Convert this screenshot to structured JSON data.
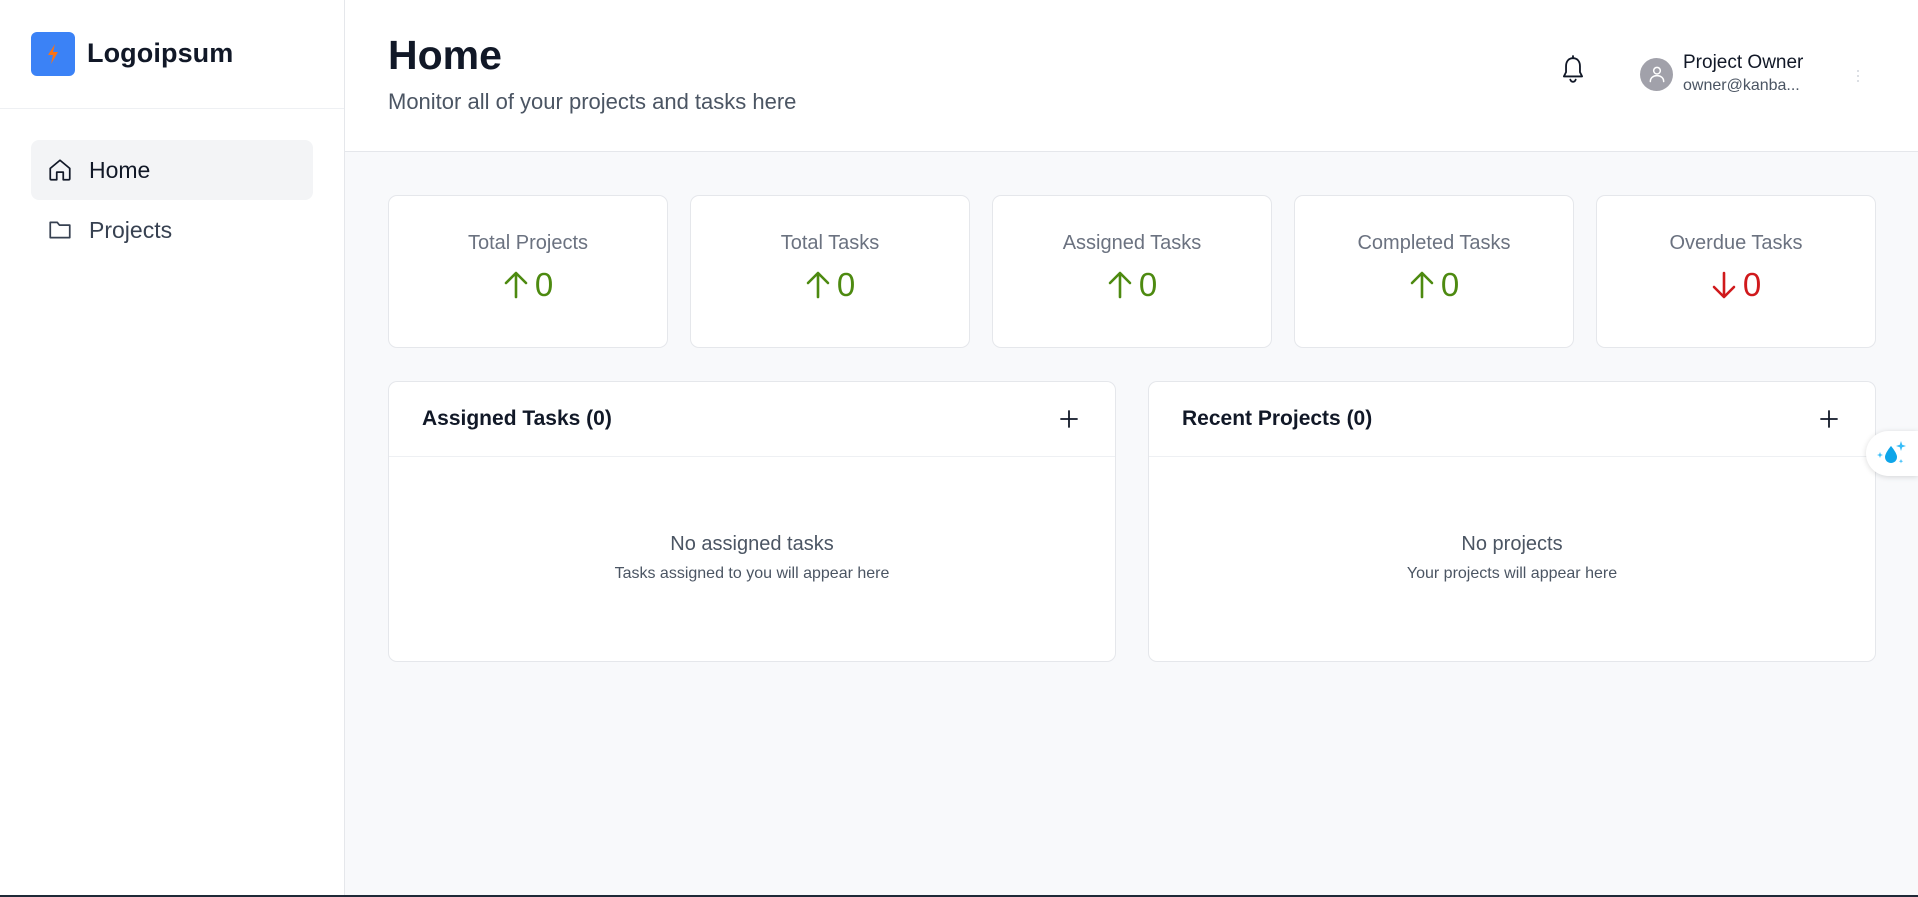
{
  "brand": {
    "name": "Logoipsum",
    "accent": "#3b82f6",
    "bolt_color": "#f97316"
  },
  "sidebar": {
    "items": [
      {
        "label": "Home",
        "icon": "home-icon",
        "active": true
      },
      {
        "label": "Projects",
        "icon": "folder-icon",
        "active": false
      }
    ]
  },
  "header": {
    "title": "Home",
    "subtitle": "Monitor all of your projects and tasks here",
    "user": {
      "name": "Project Owner",
      "email": "owner@kanba..."
    }
  },
  "stats": [
    {
      "label": "Total Projects",
      "value": "0",
      "trend": "up"
    },
    {
      "label": "Total Tasks",
      "value": "0",
      "trend": "up"
    },
    {
      "label": "Assigned Tasks",
      "value": "0",
      "trend": "up"
    },
    {
      "label": "Completed Tasks",
      "value": "0",
      "trend": "up"
    },
    {
      "label": "Overdue Tasks",
      "value": "0",
      "trend": "down"
    }
  ],
  "panels": {
    "assigned": {
      "title": "Assigned Tasks (0)",
      "empty_title": "No assigned tasks",
      "empty_sub": "Tasks assigned to you will appear here"
    },
    "recent": {
      "title": "Recent Projects (0)",
      "empty_title": "No projects",
      "empty_sub": "Your projects will appear here"
    }
  },
  "colors": {
    "trend_up": "#4d8a10",
    "trend_down": "#d0191c"
  }
}
